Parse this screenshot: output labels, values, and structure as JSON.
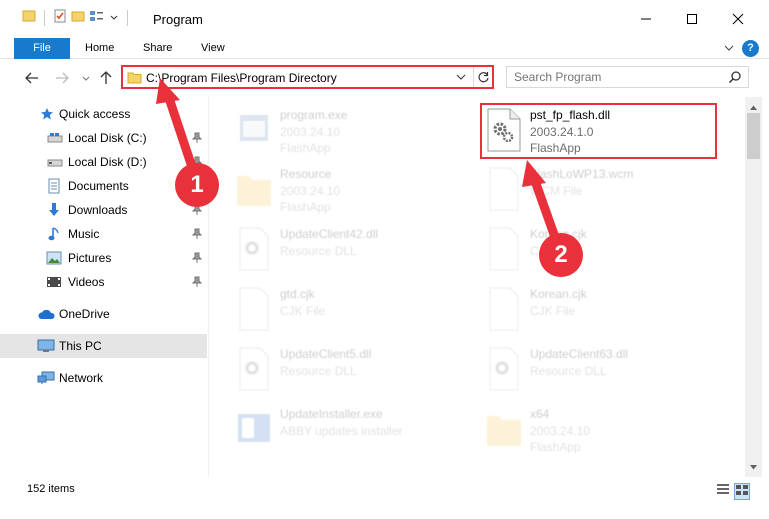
{
  "window": {
    "title": "Program"
  },
  "ribbon": {
    "file": "File",
    "home": "Home",
    "share": "Share",
    "view": "View",
    "help": "?"
  },
  "address": {
    "path": "C:\\Program Files\\Program Directory",
    "search_placeholder": "Search Program"
  },
  "sidebar": {
    "items": [
      {
        "label": "Quick access",
        "icon": "star-icon"
      },
      {
        "label": "Local Disk (C:)",
        "icon": "drive-icon"
      },
      {
        "label": "Local Disk (D:)",
        "icon": "drive-icon"
      },
      {
        "label": "Documents",
        "icon": "documents-icon"
      },
      {
        "label": "Downloads",
        "icon": "download-icon"
      },
      {
        "label": "Music",
        "icon": "music-icon"
      },
      {
        "label": "Pictures",
        "icon": "pictures-icon"
      },
      {
        "label": "Videos",
        "icon": "videos-icon"
      },
      {
        "label": "OneDrive",
        "icon": "cloud-icon"
      },
      {
        "label": "This PC",
        "icon": "computer-icon"
      },
      {
        "label": "Network",
        "icon": "network-icon"
      }
    ]
  },
  "files": [
    {
      "name": "program.exe",
      "line1": "2003.24.10",
      "line2": "FlashApp",
      "icon": "exe-icon"
    },
    {
      "name": "pst_fp_flash.dll",
      "line1": "2003.24.1.0",
      "line2": "FlashApp",
      "icon": "dll-gear-icon"
    },
    {
      "name": "Resource",
      "line1": "2003.24.10",
      "line2": "FlashApp",
      "icon": "folder-icon"
    },
    {
      "name": "FlashLoWP13.wcm",
      "line1": "WCM File",
      "line2": "",
      "icon": "blank-file-icon"
    },
    {
      "name": "UpdateClient42.dll",
      "line1": "Resource DLL",
      "line2": "",
      "icon": "dll-gear-icon"
    },
    {
      "name": "Korean.cjk",
      "line1": "CJK File",
      "line2": "",
      "icon": "blank-file-icon"
    },
    {
      "name": "gtd.cjk",
      "line1": "CJK File",
      "line2": "",
      "icon": "blank-file-icon"
    },
    {
      "name": "Korean.cjk",
      "line1": "CJK File",
      "line2": "",
      "icon": "blank-file-icon"
    },
    {
      "name": "UpdateClient5.dll",
      "line1": "Resource DLL",
      "line2": "",
      "icon": "dll-gear-icon"
    },
    {
      "name": "UpdateClient63.dll",
      "line1": "Resource DLL",
      "line2": "",
      "icon": "dll-gear-icon"
    },
    {
      "name": "UpdateInstaller.exe",
      "line1": "ABBY updates installer",
      "line2": "",
      "icon": "installer-icon"
    },
    {
      "name": "x64",
      "line1": "2003.24.10",
      "line2": "FlashApp",
      "icon": "folder-icon"
    }
  ],
  "status": {
    "count": "152 items"
  },
  "markers": {
    "one": "1",
    "two": "2"
  },
  "colors": {
    "accent": "#1979ca",
    "annotation": "#e8313b"
  }
}
